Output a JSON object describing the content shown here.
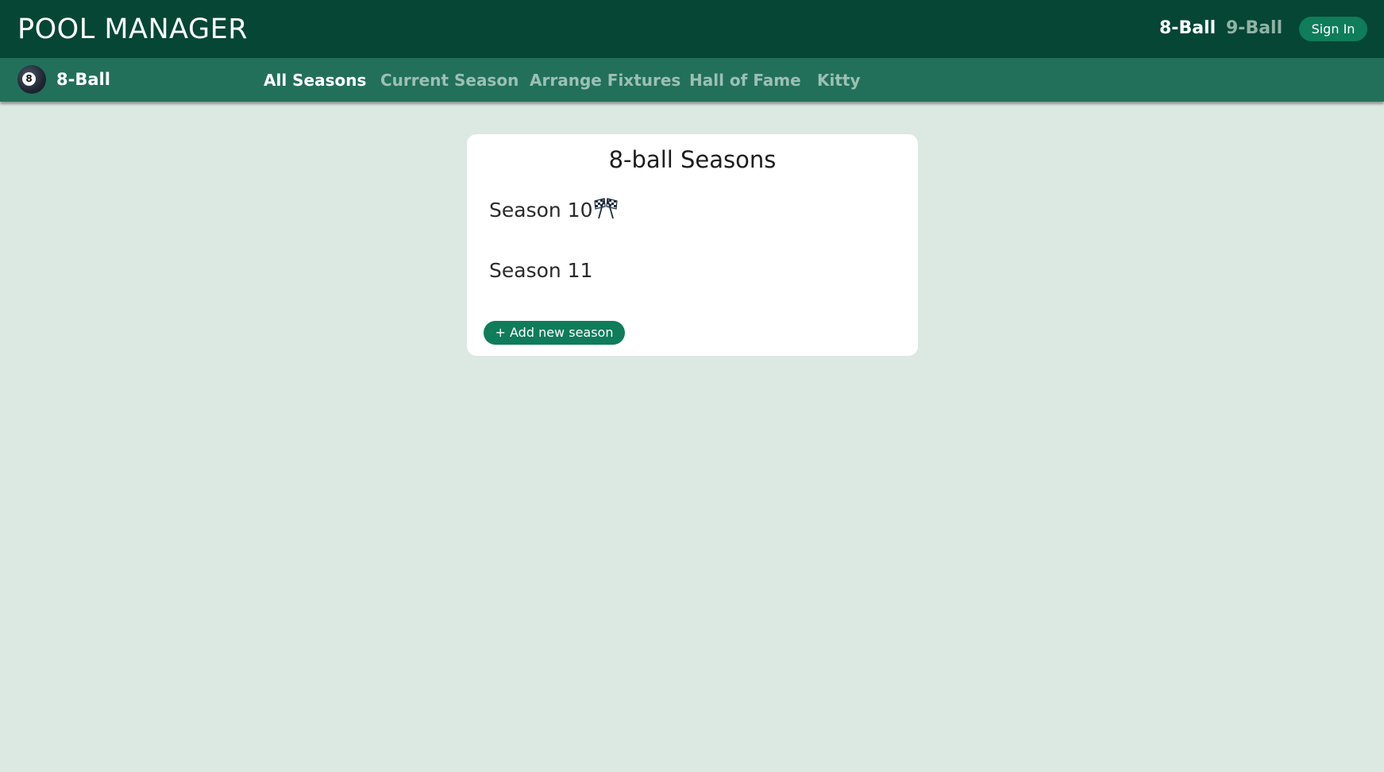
{
  "header": {
    "title": "POOL MANAGER",
    "games": [
      "8-Ball",
      "9-Ball"
    ],
    "active_game": "8-Ball",
    "sign_in_label": "Sign In"
  },
  "subnav": {
    "game_icon": "eight-ball-icon",
    "game_label": "8-Ball",
    "items": [
      {
        "label": "All Seasons",
        "active": true
      },
      {
        "label": "Current Season",
        "active": false
      },
      {
        "label": "Arrange Fixtures",
        "active": false
      },
      {
        "label": "Hall of Fame",
        "active": false
      },
      {
        "label": "Kitty",
        "active": false
      }
    ]
  },
  "seasons_card": {
    "title": "8-ball Seasons",
    "seasons": [
      {
        "label": "Season 10",
        "icon": "checkered-flags-icon"
      },
      {
        "label": "Season 11"
      }
    ],
    "add_label": "+ Add new season"
  },
  "colors": {
    "header_bg": "#054634",
    "subnav_bg": "#22705a",
    "accent": "#0f7c5a",
    "page_bg": "#dce8e2"
  }
}
